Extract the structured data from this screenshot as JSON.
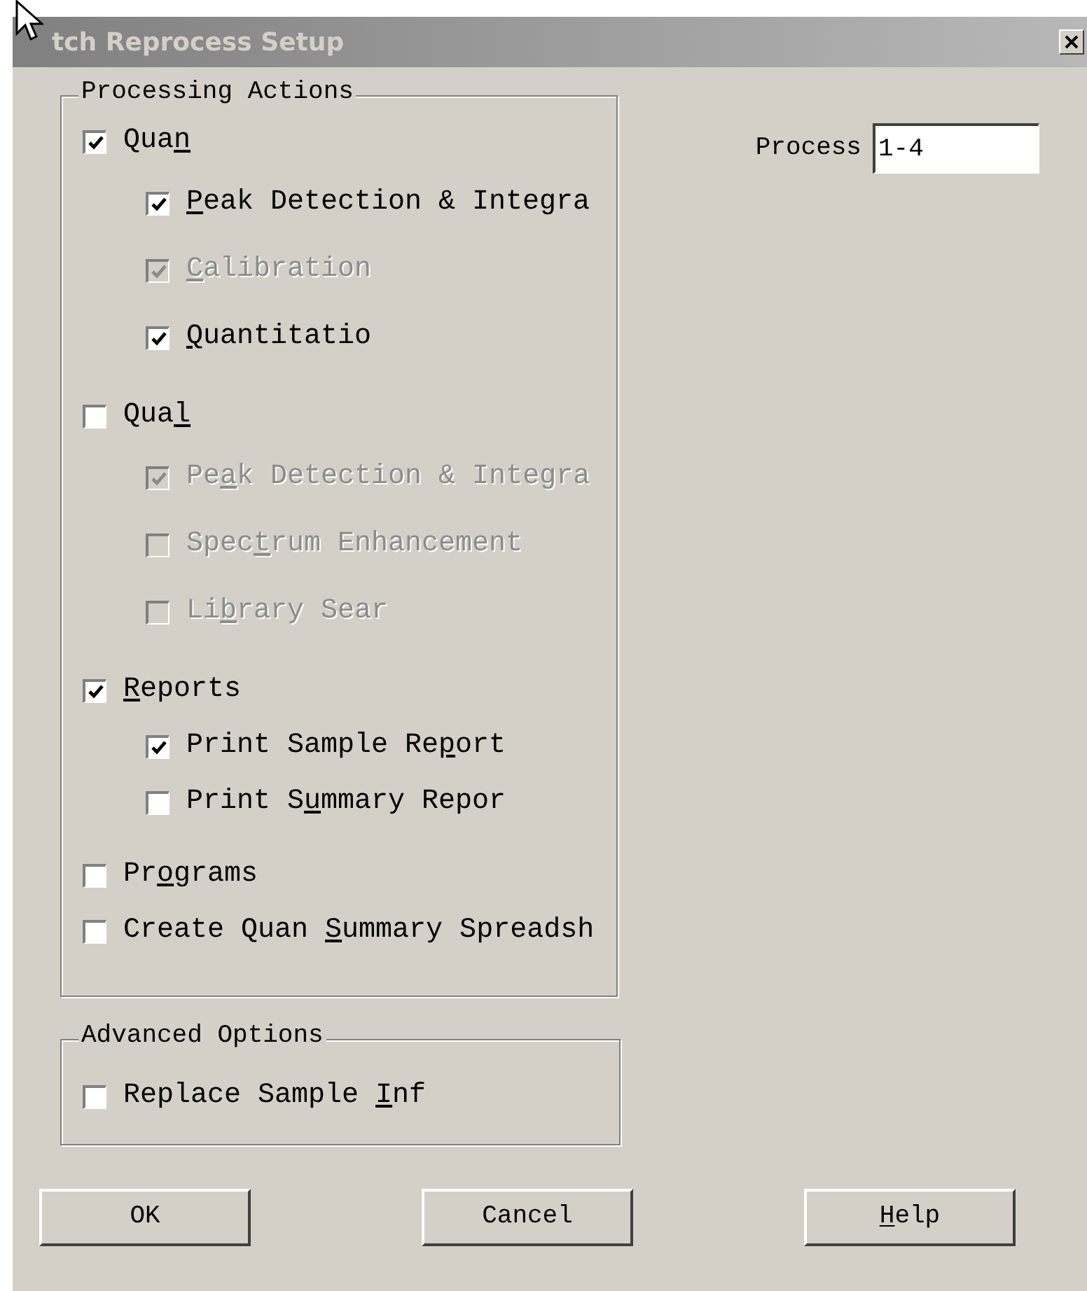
{
  "window": {
    "title": "tch Reprocess Setup"
  },
  "processing_actions": {
    "title": "Processing Actions",
    "items": [
      {
        "label": [
          {
            "text": "Qua",
            "underlined": false
          },
          {
            "text": "n",
            "underlined": true
          }
        ],
        "checked": true,
        "disabled": false,
        "children": [
          {
            "label": [
              {
                "text": "P",
                "underlined": true
              },
              {
                "text": "eak Detection & Integra",
                "underlined": false
              }
            ],
            "checked": true,
            "disabled": false
          },
          {
            "label": [
              {
                "text": "C",
                "underlined": true
              },
              {
                "text": "alibration",
                "underlined": false
              }
            ],
            "checked": true,
            "disabled": true
          },
          {
            "label": [
              {
                "text": "Q",
                "underlined": true
              },
              {
                "text": "uantitatio",
                "underlined": false
              }
            ],
            "checked": true,
            "disabled": false
          }
        ]
      },
      {
        "label": [
          {
            "text": "Qua",
            "underlined": false
          },
          {
            "text": "l",
            "underlined": true
          }
        ],
        "checked": false,
        "disabled": false,
        "children": [
          {
            "label": [
              {
                "text": "Pe",
                "underlined": false
              },
              {
                "text": "a",
                "underlined": true
              },
              {
                "text": "k Detection & Integra",
                "underlined": false
              }
            ],
            "checked": true,
            "disabled": true
          },
          {
            "label": [
              {
                "text": "Spec",
                "underlined": false
              },
              {
                "text": "t",
                "underlined": true
              },
              {
                "text": "rum Enhancement",
                "underlined": false
              }
            ],
            "checked": false,
            "disabled": true
          },
          {
            "label": [
              {
                "text": "Li",
                "underlined": false
              },
              {
                "text": "b",
                "underlined": true
              },
              {
                "text": "rary Sear",
                "underlined": false
              }
            ],
            "checked": false,
            "disabled": true
          }
        ]
      },
      {
        "label": [
          {
            "text": "R",
            "underlined": true
          },
          {
            "text": "eports",
            "underlined": false
          }
        ],
        "checked": true,
        "disabled": false,
        "children": [
          {
            "label": [
              {
                "text": "Print Sample Re",
                "underlined": false
              },
              {
                "text": "p",
                "underlined": true
              },
              {
                "text": "ort",
                "underlined": false
              }
            ],
            "checked": true,
            "disabled": false
          },
          {
            "label": [
              {
                "text": "Print S",
                "underlined": false
              },
              {
                "text": "u",
                "underlined": true
              },
              {
                "text": "mmary Repor",
                "underlined": false
              }
            ],
            "checked": false,
            "disabled": false
          }
        ]
      },
      {
        "label": [
          {
            "text": "Pr",
            "underlined": false
          },
          {
            "text": "o",
            "underlined": true
          },
          {
            "text": "grams",
            "underlined": false
          }
        ],
        "checked": false,
        "disabled": false
      },
      {
        "label": [
          {
            "text": "Create Quan ",
            "underlined": false
          },
          {
            "text": "S",
            "underlined": true
          },
          {
            "text": "ummary Spreadsh",
            "underlined": false
          }
        ],
        "checked": false,
        "disabled": false
      }
    ]
  },
  "process": {
    "label": "Process",
    "value": "1-4"
  },
  "advanced_options": {
    "title": "Advanced Options",
    "items": [
      {
        "label": [
          {
            "text": "Replace Sample ",
            "underlined": false
          },
          {
            "text": "I",
            "underlined": true
          },
          {
            "text": "nf",
            "underlined": false
          }
        ],
        "checked": false,
        "disabled": false
      }
    ]
  },
  "buttons": [
    {
      "label": [
        {
          "text": "OK",
          "underlined": false
        }
      ]
    },
    {
      "label": [
        {
          "text": "Cancel",
          "underlined": false
        }
      ]
    },
    {
      "label": [
        {
          "text": "H",
          "underlined": true
        },
        {
          "text": "elp",
          "underlined": false
        }
      ]
    }
  ]
}
